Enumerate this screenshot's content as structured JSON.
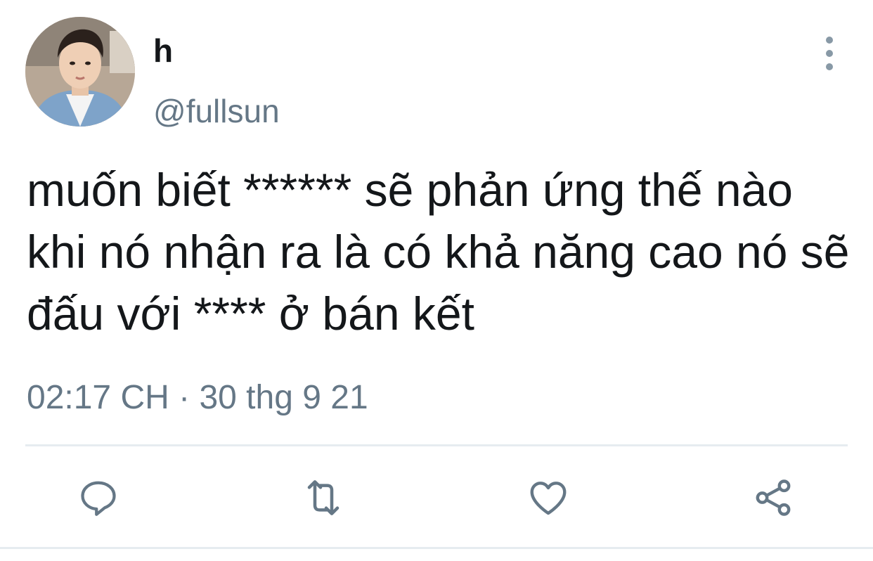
{
  "tweet": {
    "author": {
      "display_name": "h",
      "handle": "@fullsun"
    },
    "text": "muốn biết ****** sẽ phản ứng thế nào khi nó nhận ra là có khả năng cao nó sẽ đấu với **** ở bán kết",
    "timestamp": "02:17 CH · 30 thg 9 21"
  },
  "colors": {
    "primary_text": "#14171a",
    "secondary_text": "#657786",
    "icon": "#657786",
    "divider": "#e6ecf0"
  },
  "icons": {
    "more": "more-vertical-icon",
    "reply": "reply-icon",
    "retweet": "retweet-icon",
    "like": "like-icon",
    "share": "share-icon"
  }
}
